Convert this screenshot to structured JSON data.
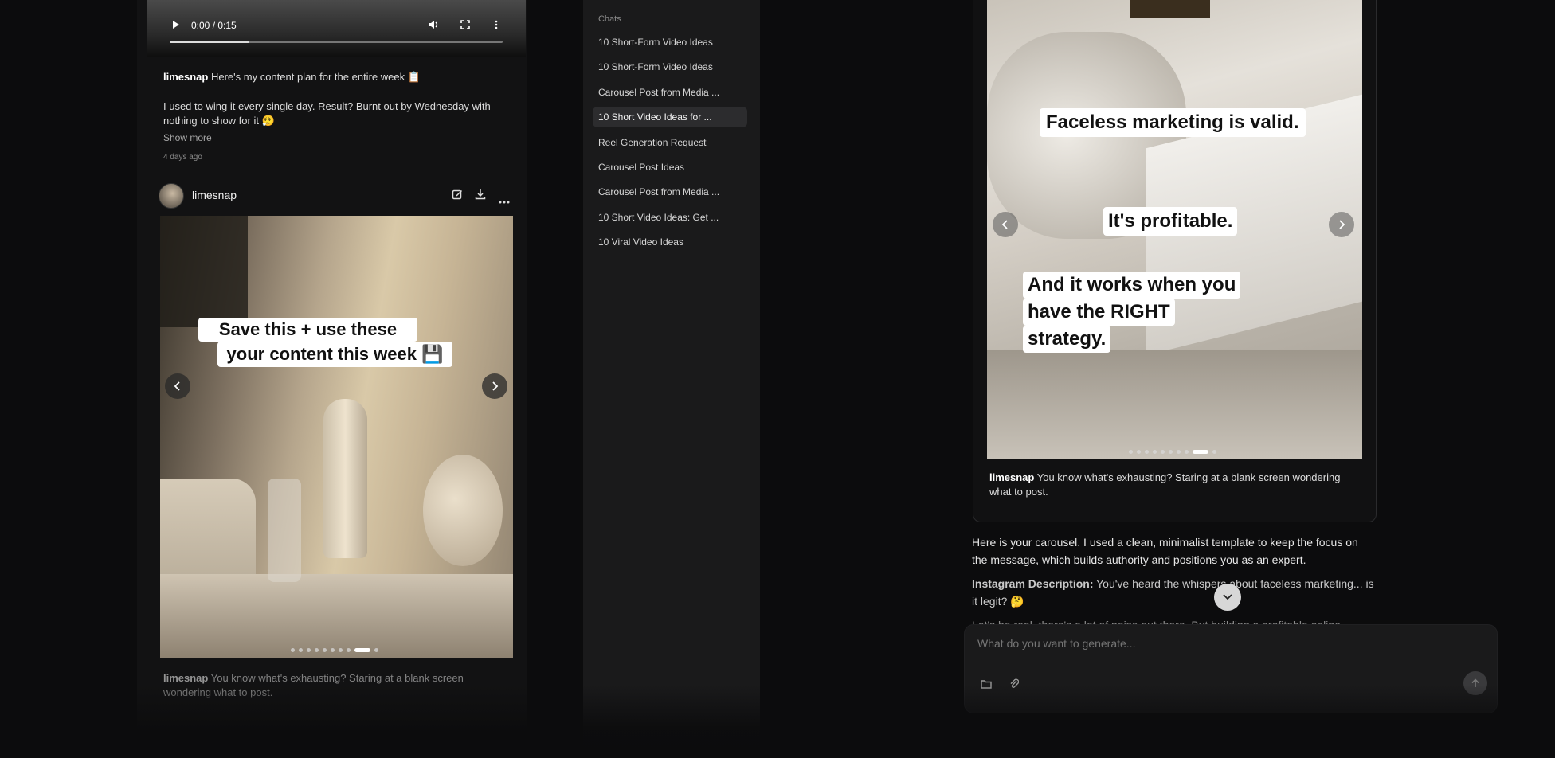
{
  "feed": {
    "video": {
      "time_label": "0:00 / 0:15",
      "progress": 0.24
    },
    "post1": {
      "username": "limesnap",
      "caption_line1": "Here's my content plan for the entire week 📋",
      "caption_line2": "I used to wing it every single day. Result? Burnt out by Wednesday with nothing to show for it 😮‍💨",
      "show_more": "Show more",
      "timestamp": "4 days ago"
    },
    "post2": {
      "username": "limesnap",
      "overlay_line1": "Save this + use these ideas in",
      "overlay_line2": "your content this week 💾",
      "caption": "You know what's exhausting? Staring at a blank screen wondering what to post.",
      "slide_count": 10,
      "active_slide": 9
    },
    "icons": [
      "edit-icon",
      "download-icon",
      "more-icon",
      "chevron-left-icon",
      "chevron-right-icon"
    ]
  },
  "sidebar": {
    "section_title": "Chats",
    "items": [
      {
        "label": "10 Short-Form Video Ideas",
        "active": false
      },
      {
        "label": "10 Short-Form Video Ideas",
        "active": false
      },
      {
        "label": "Carousel Post from Media ...",
        "active": false
      },
      {
        "label": "10 Short Video Ideas for ...",
        "active": true
      },
      {
        "label": "Reel Generation Request",
        "active": false
      },
      {
        "label": "Carousel Post Ideas",
        "active": false
      },
      {
        "label": "Carousel Post from Media ...",
        "active": false
      },
      {
        "label": "10 Short Video Ideas: Get ...",
        "active": false
      },
      {
        "label": "10 Viral Video Ideas",
        "active": false
      }
    ]
  },
  "chat": {
    "preview": {
      "overlay1": "Faceless marketing is valid.",
      "overlay2": "It's profitable.",
      "overlay3_line1": "And it works when you",
      "overlay3_line2": "have the RIGHT",
      "overlay3_line3": "strategy.",
      "username": "limesnap",
      "caption": "You know what's exhausting? Staring at a blank screen wondering what to post.",
      "slide_count": 10,
      "active_slide": 9
    },
    "message1": "Here is your carousel. I used a clean, minimalist template to keep the focus on the message, which builds authority and positions you as an expert.",
    "message2_label": "Instagram Description:",
    "message2_text": "You've heard the whispers about faceless marketing... is it legit? 🤔",
    "message3_partial": "Let's be real, there's a lot of noise out there. But building a profitable online",
    "input_placeholder": "What do you want to generate...",
    "icons": [
      "folder-icon",
      "paperclip-icon",
      "send-icon",
      "scroll-down-icon"
    ]
  }
}
